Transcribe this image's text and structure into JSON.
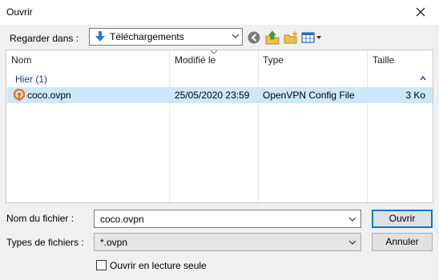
{
  "window": {
    "title": "Ouvrir",
    "close_icon": "close-icon"
  },
  "lookin": {
    "label": "Regarder dans :",
    "value": "Téléchargements",
    "folder_icon": "download-folder-icon"
  },
  "toolbar": {
    "icons": [
      "back-icon",
      "up-folder-icon",
      "new-folder-icon",
      "view-menu-icon"
    ]
  },
  "list": {
    "columns": [
      "Nom",
      "Modifié le",
      "Type",
      "Taille"
    ],
    "group": "Hier (1)",
    "files": [
      {
        "name": "coco.ovpn",
        "modified": "25/05/2020 23:59",
        "type": "OpenVPN Config File",
        "size": "3 Ko",
        "selected": true
      }
    ]
  },
  "filename": {
    "label": "Nom du fichier :",
    "value": "coco.ovpn"
  },
  "filetype": {
    "label": "Types de fichiers :",
    "value": "*.ovpn"
  },
  "buttons": {
    "open": "Ouvrir",
    "cancel": "Annuler"
  },
  "readonly": {
    "label": "Ouvrir en lecture seule",
    "checked": false
  },
  "colors": {
    "accent": "#0078d7",
    "selection": "#cce8ff",
    "group_text": "#1e3287"
  }
}
